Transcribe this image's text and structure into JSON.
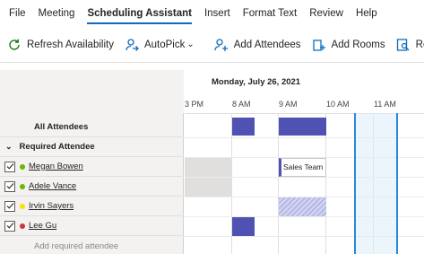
{
  "menu": {
    "tabs": [
      "File",
      "Meeting",
      "Scheduling Assistant",
      "Insert",
      "Format Text",
      "Review",
      "Help"
    ],
    "active_tab": "Scheduling Assistant"
  },
  "toolbar": {
    "refresh": {
      "label": "Refresh Availability",
      "icon": "refresh-icon"
    },
    "autopick": {
      "label": "AutoPick",
      "icon": "autopick-icon",
      "chevron": "⌄"
    },
    "add_attendees": {
      "label": "Add Attendees",
      "icon": "add-attendee-icon"
    },
    "add_rooms": {
      "label": "Add Rooms",
      "icon": "add-room-icon"
    },
    "room_finder": {
      "label": "Ro",
      "icon": "room-finder-icon"
    }
  },
  "schedule": {
    "date": "Monday, July 26, 2021",
    "times": [
      "3 PM",
      "8 AM",
      "9 AM",
      "10 AM",
      "11 AM"
    ],
    "all_attendees": "All Attendees",
    "required_group": "Required Attendee",
    "attendees": [
      {
        "name": "Megan Bowen",
        "status_color": "#6bb700"
      },
      {
        "name": "Adele Vance",
        "status_color": "#6bb700"
      },
      {
        "name": "Irvin Sayers",
        "status_color": "#fce100"
      },
      {
        "name": "Lee Gu",
        "status_color": "#d13438"
      }
    ],
    "add_placeholder": "Add required attendee",
    "meeting_label": "Sales Team"
  },
  "colors": {
    "accent": "#0f6cbd",
    "busy": "#4f52b2",
    "selection": "#2b88d8"
  }
}
